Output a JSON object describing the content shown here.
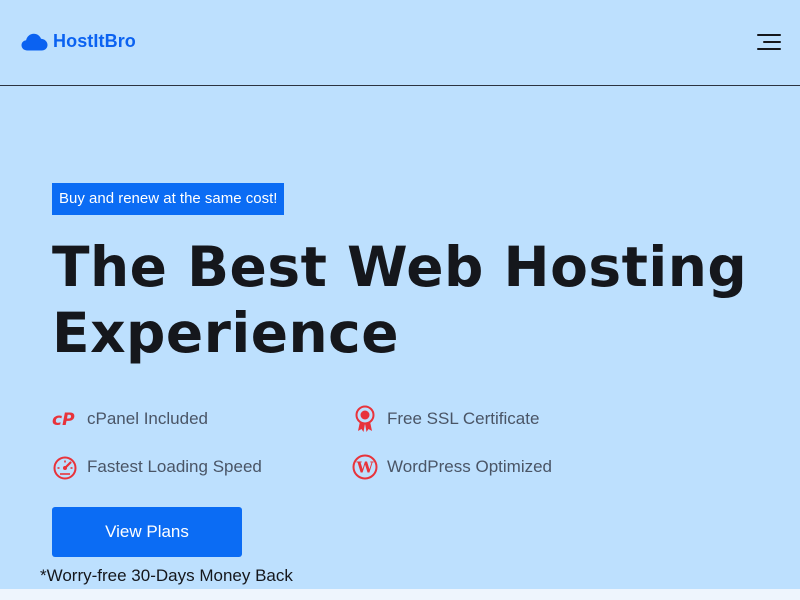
{
  "header": {
    "brand": "HostItBro",
    "menu_icon": "hamburger-menu-icon"
  },
  "hero": {
    "badge": "Buy and renew at the same cost!",
    "title_line1": "The Best Web Hosting",
    "title_line2": "Experience",
    "features": [
      {
        "label": "cPanel Included",
        "icon": "cpanel-icon"
      },
      {
        "label": "Free SSL Certificate",
        "icon": "ssl-award-icon"
      },
      {
        "label": "Fastest Loading Speed",
        "icon": "speedometer-icon"
      },
      {
        "label": "WordPress Optimized",
        "icon": "wordpress-icon"
      }
    ],
    "cta_label": "View Plans",
    "note": "*Worry-free 30-Days Money Back"
  },
  "colors": {
    "background": "#bde0fe",
    "brand_blue": "#0b6cf4",
    "logo_blue": "#0b62f1",
    "icon_red": "#e8333b",
    "text_dark": "#15171c",
    "text_muted": "#4a5566"
  }
}
